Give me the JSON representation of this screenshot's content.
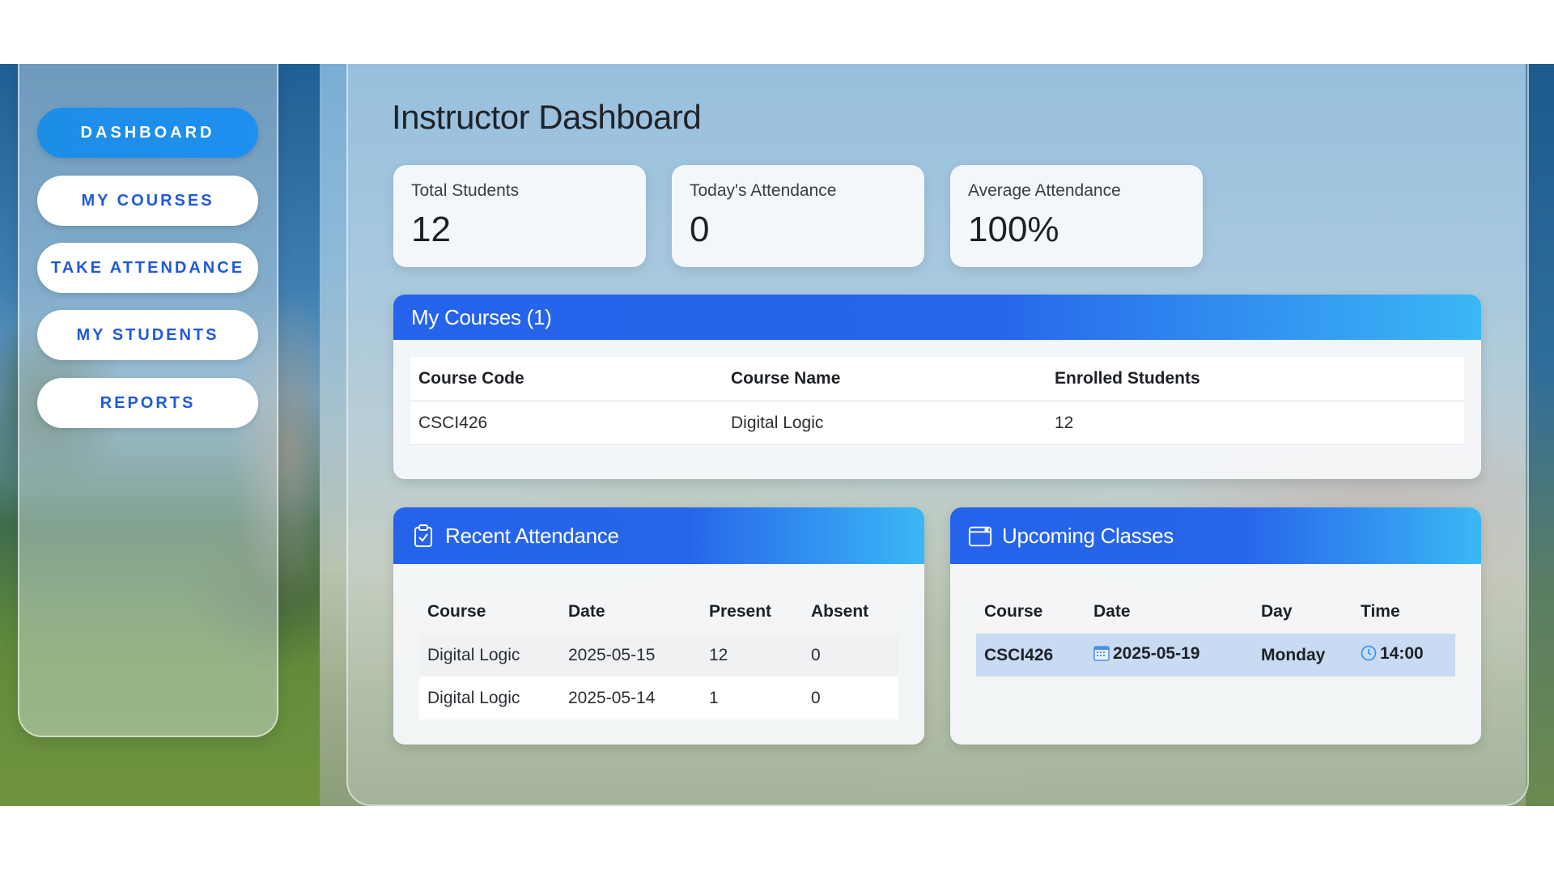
{
  "sidebar": {
    "items": [
      {
        "label": "DASHBOARD",
        "active": true
      },
      {
        "label": "MY COURSES",
        "active": false
      },
      {
        "label": "TAKE ATTENDANCE",
        "active": false
      },
      {
        "label": "MY STUDENTS",
        "active": false
      },
      {
        "label": "REPORTS",
        "active": false
      }
    ]
  },
  "main": {
    "title": "Instructor Dashboard",
    "stats": [
      {
        "label": "Total Students",
        "value": "12"
      },
      {
        "label": "Today's Attendance",
        "value": "0"
      },
      {
        "label": "Average Attendance",
        "value": "100%"
      }
    ],
    "courses": {
      "title": "My Courses (1)",
      "headers": [
        "Course Code",
        "Course Name",
        "Enrolled Students"
      ],
      "rows": [
        [
          "CSCI426",
          "Digital Logic",
          "12"
        ]
      ]
    },
    "recent_attendance": {
      "title": "Recent Attendance",
      "icon": "clipboard-check-icon",
      "headers": [
        "Course",
        "Date",
        "Present",
        "Absent"
      ],
      "rows": [
        [
          "Digital Logic",
          "2025-05-15",
          "12",
          "0"
        ],
        [
          "Digital Logic",
          "2025-05-14",
          "1",
          "0"
        ]
      ]
    },
    "upcoming_classes": {
      "title": "Upcoming Classes",
      "icon": "calendar-icon",
      "headers": [
        "Course",
        "Date",
        "Day",
        "Time"
      ],
      "rows": [
        [
          "CSCI426",
          "2025-05-19",
          "Monday",
          "14:00"
        ]
      ]
    }
  },
  "colors": {
    "accent": "#2563eb",
    "accent_light": "#3ab8f5",
    "nav_active": "#1d8ee6",
    "nav_text": "#1f5ad8",
    "highlight_row": "#c9daf3"
  }
}
